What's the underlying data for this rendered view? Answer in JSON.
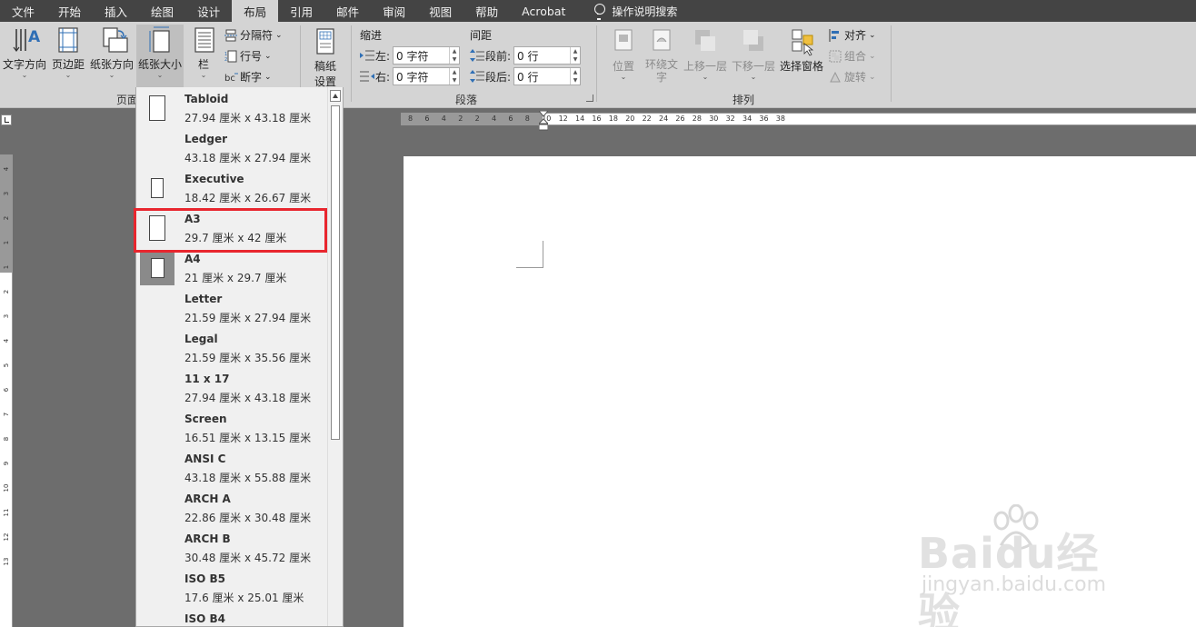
{
  "menubar": {
    "tabs": [
      "文件",
      "开始",
      "插入",
      "绘图",
      "设计",
      "布局",
      "引用",
      "邮件",
      "审阅",
      "视图",
      "帮助",
      "Acrobat"
    ],
    "active_tab": "布局",
    "tell_me": "操作说明搜索"
  },
  "ribbon": {
    "page_setup": {
      "text_direction": "文字方向",
      "margins": "页边距",
      "orientation": "纸张方向",
      "size": "纸张大小",
      "columns": "栏",
      "breaks": "分隔符",
      "line_numbers": "行号",
      "hyphenation": "断字",
      "group_label": "页面"
    },
    "draft": {
      "label1": "稿纸",
      "label2": "设置"
    },
    "paragraph": {
      "indent_title": "缩进",
      "spacing_title": "间距",
      "left_label": "左:",
      "right_label": "右:",
      "left_value": "0 字符",
      "right_value": "0 字符",
      "before_label": "段前:",
      "after_label": "段后:",
      "before_value": "0 行",
      "after_value": "0 行",
      "group_label": "段落"
    },
    "arrange": {
      "position": "位置",
      "wrap_text_1": "环绕文",
      "wrap_text_2": "字",
      "bring_forward": "上移一层",
      "send_backward": "下移一层",
      "selection_pane": "选择窗格",
      "align": "对齐",
      "group": "组合",
      "rotate": "旋转",
      "group_label": "排列"
    }
  },
  "paper_sizes": [
    {
      "name": "Tabloid",
      "dims": "27.94 厘米 x 43.18 厘米"
    },
    {
      "name": "Ledger",
      "dims": "43.18 厘米 x 27.94 厘米"
    },
    {
      "name": "Executive",
      "dims": "18.42 厘米 x 26.67 厘米"
    },
    {
      "name": "A3",
      "dims": "29.7 厘米 x 42 厘米"
    },
    {
      "name": "A4",
      "dims": "21 厘米 x 29.7 厘米"
    },
    {
      "name": "Letter",
      "dims": "21.59 厘米 x 27.94 厘米"
    },
    {
      "name": "Legal",
      "dims": "21.59 厘米 x 35.56 厘米"
    },
    {
      "name": "11 x 17",
      "dims": "27.94 厘米 x 43.18 厘米"
    },
    {
      "name": "Screen",
      "dims": "16.51 厘米 x 13.15 厘米"
    },
    {
      "name": "ANSI C",
      "dims": "43.18 厘米 x 55.88 厘米"
    },
    {
      "name": "ARCH A",
      "dims": "22.86 厘米 x 30.48 厘米"
    },
    {
      "name": "ARCH B",
      "dims": "30.48 厘米 x 45.72 厘米"
    },
    {
      "name": "ISO B5",
      "dims": "17.6 厘米 x 25.01 厘米"
    },
    {
      "name": "ISO B4",
      "dims": ""
    }
  ],
  "selected_paper": "A4",
  "highlighted_paper": "A3",
  "ruler": {
    "h_ticks": [
      "8",
      "6",
      "4",
      "2",
      "2",
      "4",
      "6",
      "8",
      "10",
      "12",
      "14",
      "16",
      "18",
      "20",
      "22",
      "24",
      "26",
      "28",
      "30",
      "32",
      "34",
      "36",
      "38"
    ],
    "v_ticks": [
      "4",
      "3",
      "2",
      "1",
      "1",
      "2",
      "3",
      "4",
      "5",
      "6",
      "7",
      "8",
      "9",
      "10",
      "11",
      "12",
      "13"
    ]
  },
  "watermark": {
    "main": "Baidu经验",
    "sub": "jingyan.baidu.com"
  },
  "colors": {
    "highlight": "#e8262e",
    "menubar": "#444444",
    "ribbon": "#d4d4d4"
  }
}
